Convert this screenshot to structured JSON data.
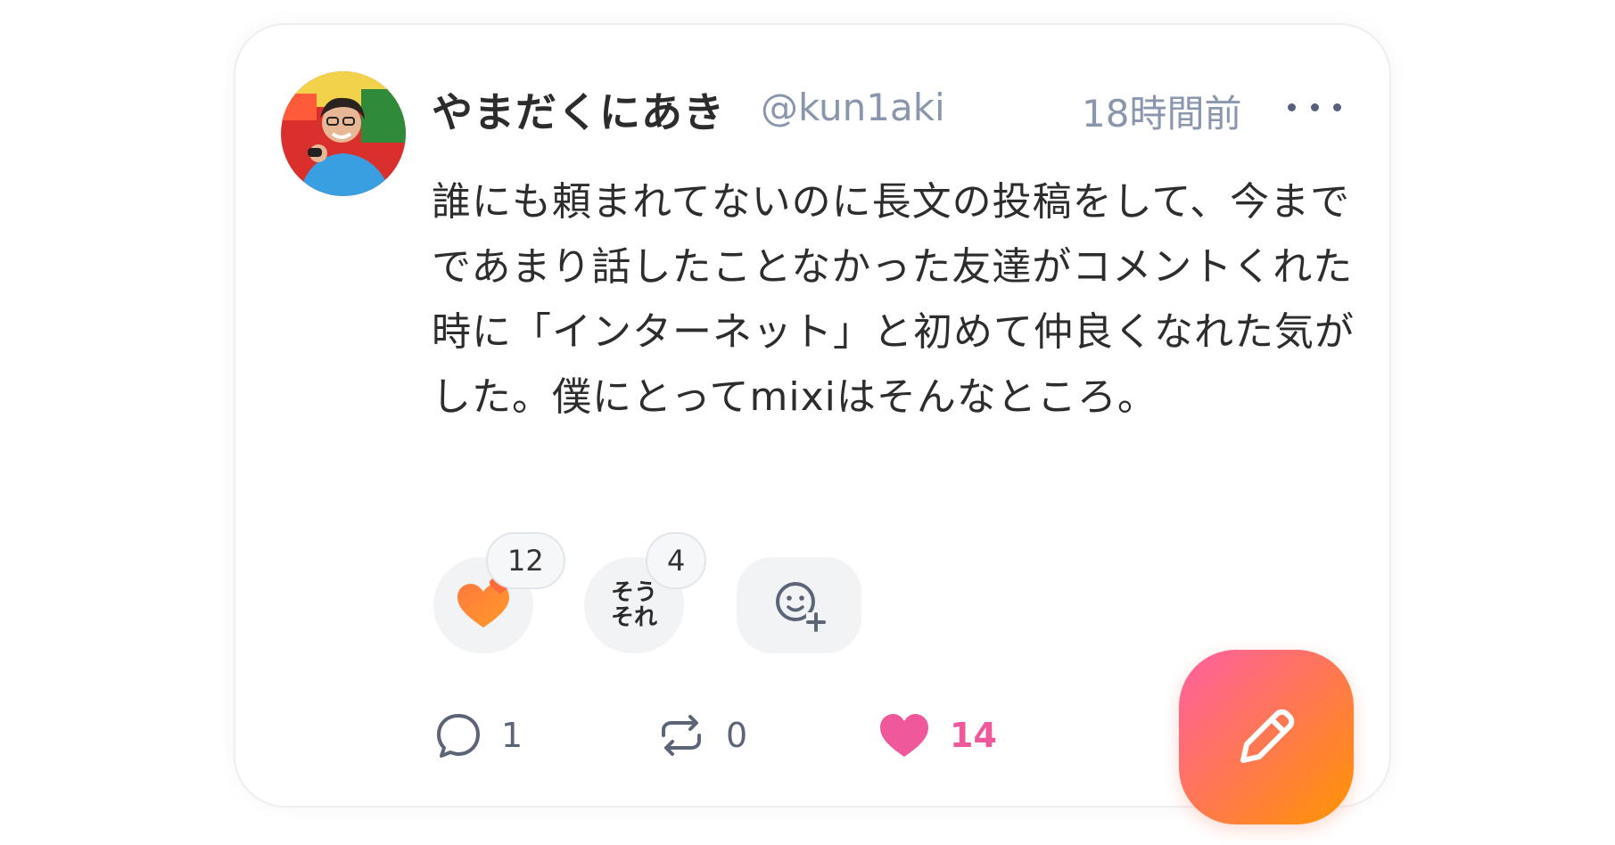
{
  "post": {
    "author_name": "やまだくにあき",
    "handle": "@kun1aki",
    "time": "18時間前",
    "body": "誰にも頼まれてないのに長文の投稿をして、今までであまり話したことなかった友達がコメントくれた時に「インターネット」と初めて仲良くなれた気がした。僕にとってmixiはそんなところ。"
  },
  "reactions": [
    {
      "icon": "heart-reaction-icon",
      "count": "12"
    },
    {
      "icon": "sou-sore-sticker-icon",
      "sticker_text": [
        "そう",
        "それ"
      ],
      "count": "4"
    }
  ],
  "actions": {
    "comments": "1",
    "reposts": "0",
    "likes": "14"
  },
  "colors": {
    "accent_pink": "#f0589c",
    "muted": "#8a96ad",
    "fab_gradient": [
      "#ff5fa2",
      "#ff9500"
    ]
  },
  "icons": [
    "more-icon",
    "add-reaction-icon",
    "comment-icon",
    "repost-icon",
    "heart-icon",
    "pencil-icon"
  ]
}
